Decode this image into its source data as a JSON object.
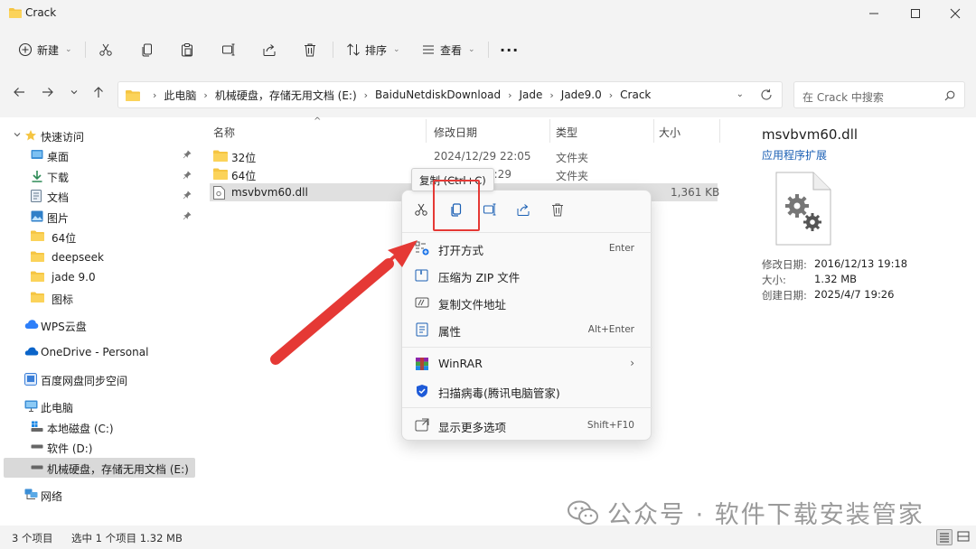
{
  "window": {
    "title": "Crack"
  },
  "toolbar": {
    "new_label": "新建",
    "sort_label": "排序",
    "view_label": "查看",
    "more_label": "···"
  },
  "address": {
    "crumbs": [
      "此电脑",
      "机械硬盘，存储无用文档 (E:)",
      "BaiduNetdiskDownload",
      "Jade",
      "Jade9.0",
      "Crack"
    ],
    "search_placeholder": "在 Crack 中搜索"
  },
  "sidebar": {
    "quick_access": "快速访问",
    "items": [
      {
        "label": "桌面",
        "icon": "desktop-icon"
      },
      {
        "label": "下载",
        "icon": "download-icon"
      },
      {
        "label": "文档",
        "icon": "document-icon"
      },
      {
        "label": "图片",
        "icon": "picture-icon"
      },
      {
        "label": "64位",
        "icon": "folder-icon"
      },
      {
        "label": "deepseek",
        "icon": "folder-icon"
      },
      {
        "label": "jade 9.0",
        "icon": "folder-icon"
      },
      {
        "label": "图标",
        "icon": "folder-icon"
      }
    ],
    "wps": "WPS云盘",
    "onedrive": "OneDrive - Personal",
    "baidu": "百度网盘同步空间",
    "this_pc": "此电脑",
    "drives": [
      "本地磁盘 (C:)",
      "软件 (D:)",
      "机械硬盘，存储无用文档 (E:)"
    ],
    "network": "网络"
  },
  "columns": {
    "name": "名称",
    "date": "修改日期",
    "type": "类型",
    "size": "大小"
  },
  "files": [
    {
      "name": "32位",
      "date": "2024/12/29 22:05",
      "type": "文件夹",
      "size": ""
    },
    {
      "name": "64位",
      "date": "9:29",
      "type": "文件夹",
      "size": ""
    },
    {
      "name": "msvbvm60.dll",
      "date": "",
      "type": "",
      "size": "1,361 KB"
    }
  ],
  "details": {
    "name": "msvbvm60.dll",
    "type": "应用程序扩展",
    "props": [
      {
        "label": "修改日期:",
        "value": "2016/12/13 19:18"
      },
      {
        "label": "大小:",
        "value": "1.32 MB"
      },
      {
        "label": "创建日期:",
        "value": "2025/4/7 19:26"
      }
    ]
  },
  "tooltip": "复制 (Ctrl+C)",
  "context_menu": {
    "open_with": {
      "label": "打开方式",
      "shortcut": "Enter"
    },
    "zip": {
      "label": "压缩为 ZIP 文件"
    },
    "copy_path": {
      "label": "复制文件地址"
    },
    "properties": {
      "label": "属性",
      "shortcut": "Alt+Enter"
    },
    "winrar": {
      "label": "WinRAR"
    },
    "scan": {
      "label": "扫描病毒(腾讯电脑管家)"
    },
    "more": {
      "label": "显示更多选项",
      "shortcut": "Shift+F10"
    }
  },
  "status": {
    "count": "3 个项目",
    "selected": "选中 1 个项目  1.32 MB"
  },
  "watermark": "公众号 · 软件下载安装管家",
  "colors": {
    "accent": "#1a5fb4",
    "highlight": "#e53935",
    "folder": "#f5c542"
  }
}
